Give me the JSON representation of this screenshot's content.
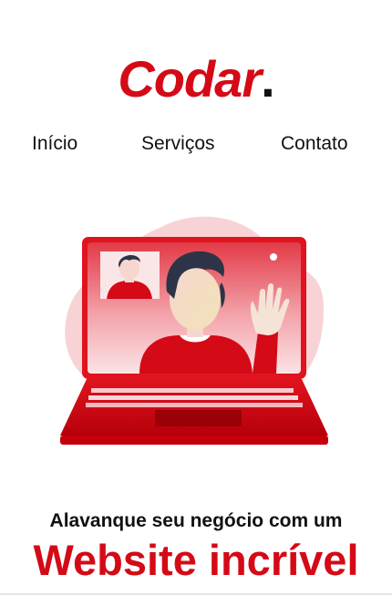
{
  "header": {
    "logo_text": "Codar",
    "logo_dot": "."
  },
  "nav": {
    "items": [
      {
        "label": "Início"
      },
      {
        "label": "Serviços"
      },
      {
        "label": "Contato"
      }
    ]
  },
  "hero": {
    "illustration_icon": "video-call-laptop-icon",
    "tagline": "Alavanque seu negócio com um",
    "headline": "Website incrível"
  },
  "colors": {
    "brand_red": "#d40a16",
    "text_dark": "#111111",
    "blob_pink": "#f7d3d6"
  }
}
